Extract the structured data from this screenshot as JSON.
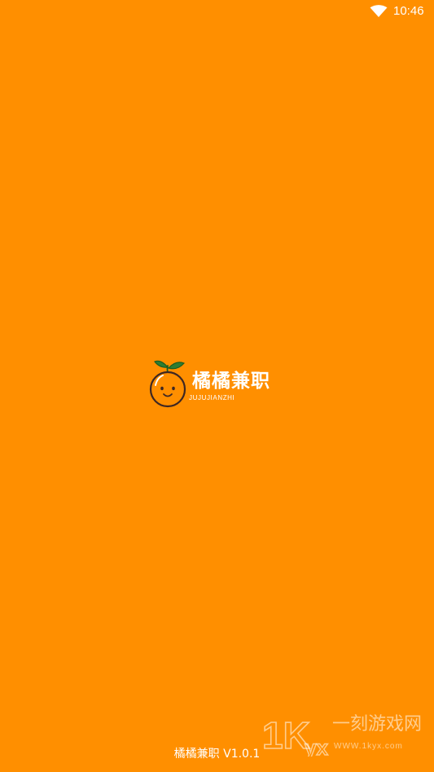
{
  "status_bar": {
    "time": "10:46",
    "icons": [
      "wifi-icon"
    ]
  },
  "splash": {
    "logo_icon": "orange-mascot-icon",
    "app_name": "橘橘兼职",
    "app_name_pinyin": "JUJUJIANZHI",
    "version": "橘橘兼职 V1.0.1"
  },
  "watermark": {
    "logo_text": "1KYX",
    "name": "一刻游戏网",
    "url": "WWW.1kyx.com"
  },
  "colors": {
    "background": "#FF8F00",
    "fruit_body": "#FF8F00",
    "leaf": "#2E7D32",
    "text": "#FFFFFF"
  }
}
